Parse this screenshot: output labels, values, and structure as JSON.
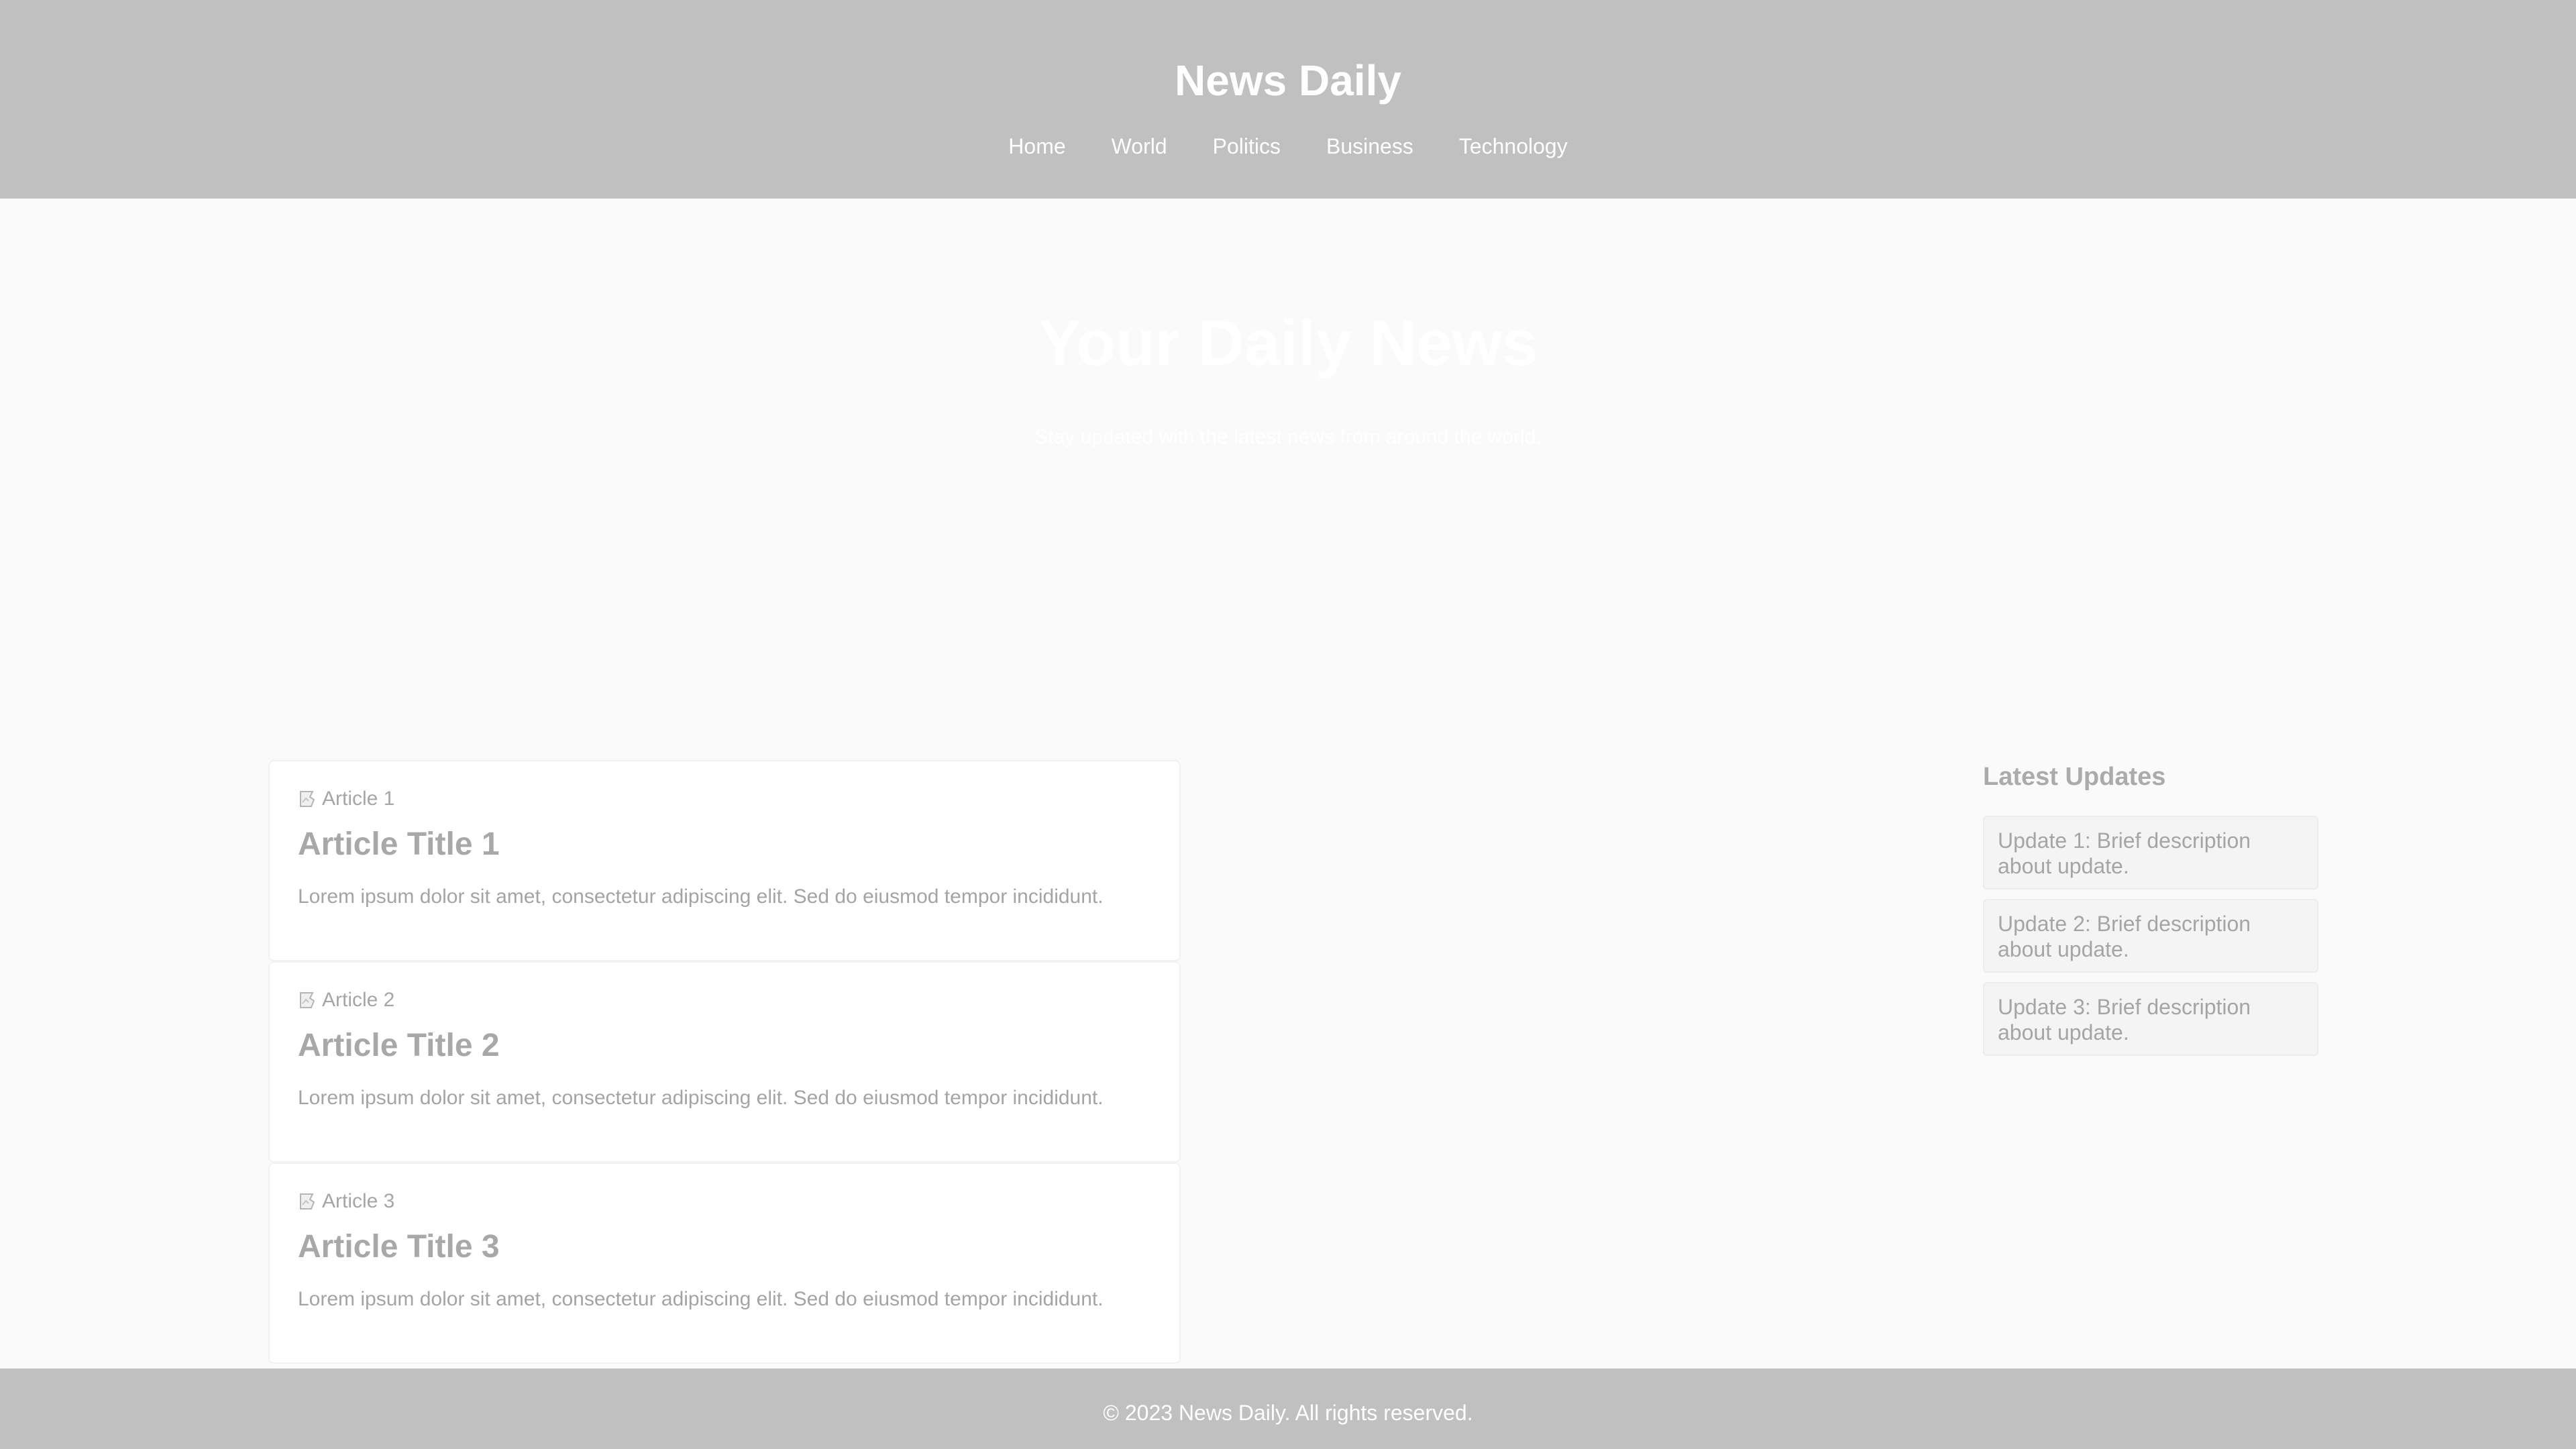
{
  "header": {
    "title": "News Daily",
    "nav": [
      "Home",
      "World",
      "Politics",
      "Business",
      "Technology"
    ]
  },
  "hero": {
    "title": "Your Daily News",
    "subtitle": "Stay updated with the latest news from around the world."
  },
  "articles": [
    {
      "image_alt": "Article 1",
      "title": "Article Title 1",
      "excerpt": "Lorem ipsum dolor sit amet, consectetur adipiscing elit. Sed do eiusmod tempor incididunt."
    },
    {
      "image_alt": "Article 2",
      "title": "Article Title 2",
      "excerpt": "Lorem ipsum dolor sit amet, consectetur adipiscing elit. Sed do eiusmod tempor incididunt."
    },
    {
      "image_alt": "Article 3",
      "title": "Article Title 3",
      "excerpt": "Lorem ipsum dolor sit amet, consectetur adipiscing elit. Sed do eiusmod tempor incididunt."
    }
  ],
  "sidebar": {
    "heading": "Latest Updates",
    "updates": [
      "Update 1: Brief description about update.",
      "Update 2: Brief description about update.",
      "Update 3: Brief description about update."
    ]
  },
  "footer": {
    "text": "© 2023 News Daily. All rights reserved."
  },
  "icons": {
    "article_image": "broken-image-icon"
  },
  "colors": {
    "header_bg": "#c0c0c0",
    "page_bg": "#fafafa",
    "text_muted": "#a8a8a8"
  }
}
